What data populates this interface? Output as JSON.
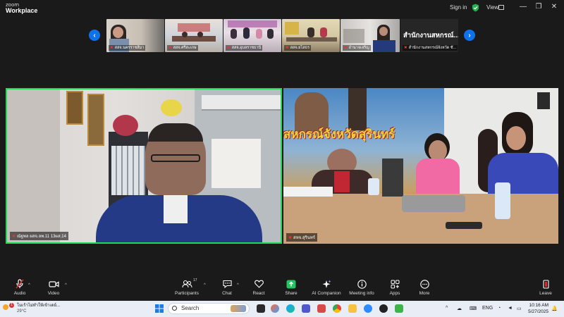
{
  "app": {
    "logo_top": "zoom",
    "logo_bottom": "Workplace"
  },
  "titlebar": {
    "signin": "Sign in",
    "view": "View"
  },
  "thumbnails": [
    {
      "name": "สสจ.นครราชสีมา"
    },
    {
      "name": "สสจ.ศรีสะเกษ"
    },
    {
      "name": "สสจ.อุบลราชธานี"
    },
    {
      "name": "สสจ.ยโสธร"
    },
    {
      "name": "อำนาจเจริญ"
    },
    {
      "name": "สำนักงานสหกรณ์จังหวัด ชั...",
      "big_text": "สำนักงานสหกรณ์..."
    }
  ],
  "videos": {
    "left_name": "ณัฐพล ผสจ.ลพ.11 13ผส.14",
    "right_name": "สหจ.สุรินทร์",
    "banner_text": "สหกรณ์จังหวัดสุรินทร์"
  },
  "toolbar": {
    "audio": "Audio",
    "video": "Video",
    "participants": "Participants",
    "participants_count": "17",
    "chat": "Chat",
    "react": "React",
    "share": "Share",
    "ai_companion": "AI Companion",
    "meeting_info": "Meeting info",
    "apps": "Apps",
    "more": "More",
    "leave": "Leave"
  },
  "taskbar": {
    "weather_line1": "โมเร้าไม่ทำให้เข้าเดย์...",
    "weather_line2": "29°C",
    "weather_badge": "1",
    "search_placeholder": "Search",
    "lang": "ENG",
    "time": "10:16 AM",
    "date": "5/27/2025"
  }
}
